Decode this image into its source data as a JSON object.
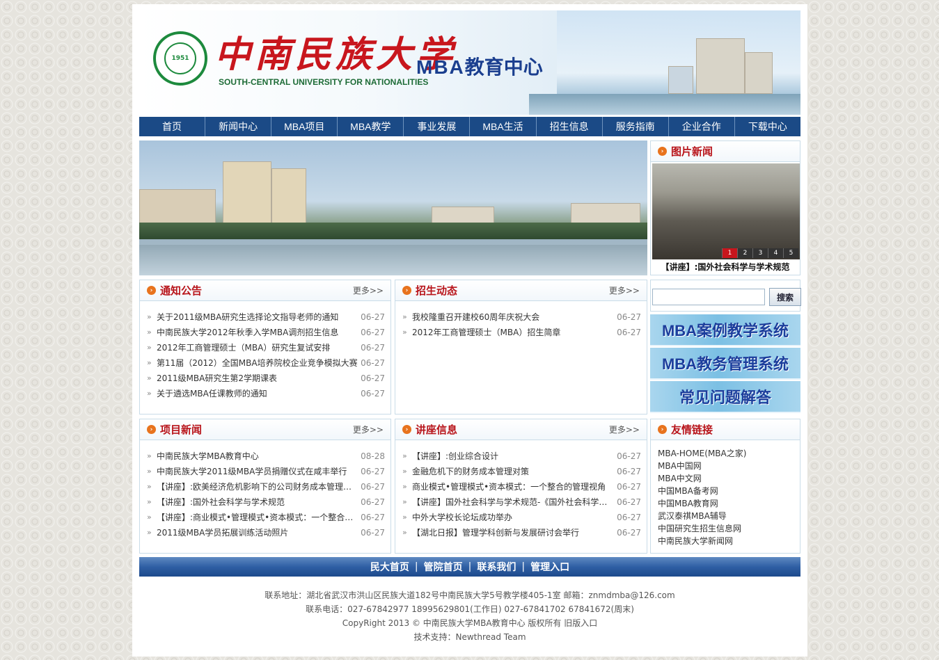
{
  "banner": {
    "school_cn": "中南民族大学",
    "school_en": "SOUTH-CENTRAL UNIVERSITY FOR NATIONALITIES",
    "seal_year": "1951",
    "mba_en": "MBA",
    "mba_cn": "教育中心"
  },
  "nav": [
    "首页",
    "新闻中心",
    "MBA项目",
    "MBA教学",
    "事业发展",
    "MBA生活",
    "招生信息",
    "服务指南",
    "企业合作",
    "下载中心"
  ],
  "picture_news": {
    "title": "图片新闻",
    "caption": "【讲座】:国外社会科学与学术规范",
    "pages": [
      "1",
      "2",
      "3",
      "4",
      "5"
    ]
  },
  "notices": {
    "title": "通知公告",
    "more": "更多>>",
    "items": [
      {
        "text": "关于2011级MBA研究生选择论文指导老师的通知",
        "date": "06-27"
      },
      {
        "text": "中南民族大学2012年秋季入学MBA调剂招生信息",
        "date": "06-27"
      },
      {
        "text": "2012年工商管理硕士（MBA）研究生复试安排",
        "date": "06-27"
      },
      {
        "text": "第11届（2012）全国MBA培养院校企业竞争模拟大赛",
        "date": "06-27"
      },
      {
        "text": "2011级MBA研究生第2学期课表",
        "date": "06-27"
      },
      {
        "text": "关于遴选MBA任课教师的通知",
        "date": "06-27"
      }
    ]
  },
  "admissions": {
    "title": "招生动态",
    "more": "更多>>",
    "items": [
      {
        "text": "我校隆重召开建校60周年庆祝大会",
        "date": "06-27"
      },
      {
        "text": "2012年工商管理硕士（MBA）招生简章",
        "date": "06-27"
      }
    ]
  },
  "search": {
    "placeholder": "",
    "button": "搜索"
  },
  "systems": [
    "MBA案例教学系统",
    "MBA教务管理系统",
    "常见问题解答"
  ],
  "project_news": {
    "title": "项目新闻",
    "more": "更多>>",
    "items": [
      {
        "text": "中南民族大学MBA教育中心",
        "date": "08-28"
      },
      {
        "text": "中南民族大学2011级MBA学员捐赠仪式在咸丰举行",
        "date": "06-27"
      },
      {
        "text": "【讲座】:欧美经济危机影响下的公司财务成本管理应...",
        "date": "06-27"
      },
      {
        "text": "【讲座】:国外社会科学与学术规范",
        "date": "06-27"
      },
      {
        "text": "【讲座】:商业模式•管理模式•资本模式：一个整合的...",
        "date": "06-27"
      },
      {
        "text": "2011级MBA学员拓展训练活动照片",
        "date": "06-27"
      }
    ]
  },
  "lectures": {
    "title": "讲座信息",
    "more": "更多>>",
    "items": [
      {
        "text": "【讲座】:创业综合设计",
        "date": "06-27"
      },
      {
        "text": "金融危机下的财务成本管理对策",
        "date": "06-27"
      },
      {
        "text": "商业模式•管理模式•资本模式：一个整合的管理视角",
        "date": "06-27"
      },
      {
        "text": "【讲座】国外社会科学与学术规范-《国外社会科学》...",
        "date": "06-27"
      },
      {
        "text": "中外大学校长论坛成功举办",
        "date": "06-27"
      },
      {
        "text": "【湖北日报】管理学科创新与发展研讨会举行",
        "date": "06-27"
      }
    ]
  },
  "friend_links": {
    "title": "友情链接",
    "items": [
      "MBA-HOME(MBA之家)",
      "MBA中国网",
      "MBA中文网",
      "中国MBA备考网",
      "中国MBA教育网",
      "武汉泰祺MBA辅导",
      "中国研究生招生信息网",
      "中南民族大学新闻网"
    ]
  },
  "footer": {
    "links": [
      "民大首页",
      "管院首页",
      "联系我们",
      "管理入口"
    ],
    "separator": "|",
    "address": "联系地址：湖北省武汉市洪山区民族大道182号中南民族大学5号教学楼405-1室 邮箱：znmdmba@126.com",
    "phone": "联系电话：027-67842977 18995629801(工作日) 027-67841702 67841672(周末)",
    "copyright": "CopyRight 2013 © 中南民族大学MBA教育中心 版权所有 旧版入口",
    "support": "技术支持：Newthread Team"
  }
}
